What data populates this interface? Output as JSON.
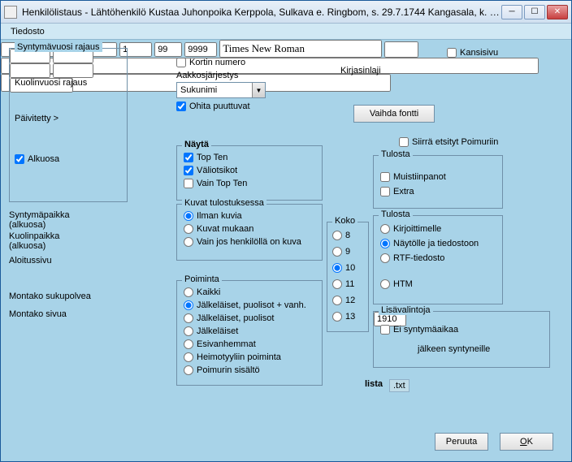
{
  "window": {
    "title": "Henkilölistaus - Lähtöhenkilö Kustaa Juhonpoika Kerppola, Sulkava e. Ringbom,  s. 29.7.1744 Kangasala, k. 1..."
  },
  "menu": {
    "file": "Tiedosto"
  },
  "birthyear": {
    "legend": "Syntymävuosi rajaus",
    "v1": "",
    "v2": ""
  },
  "deathyear": {
    "legend": "Kuolinvuosi rajaus",
    "v1": "",
    "v2": ""
  },
  "updated": {
    "label": "Päivitetty  >",
    "v": ""
  },
  "alkuosa": {
    "label": "Alkuosa"
  },
  "birthplace": {
    "label": "Syntymäpaikka (alkuosa)",
    "v": ""
  },
  "deathplace": {
    "label": "Kuolinpaikka (alkuosa)",
    "v": ""
  },
  "startpage": {
    "label": "Aloitussivu",
    "v": "1"
  },
  "generations": {
    "label": "Montako sukupolvea",
    "v": "99"
  },
  "pages": {
    "label": "Montako sivua",
    "v": "9999"
  },
  "cardno": {
    "label": "Kortin numero"
  },
  "alphaorder": {
    "label": "Aakkosjärjestys",
    "v": "Sukunimi"
  },
  "skipmissing": {
    "label": "Ohita puuttuvat"
  },
  "show": {
    "legend": "Näytä",
    "topten": "Top Ten",
    "subheads": "Väliotsikot",
    "onlytopten": "Vain Top Ten"
  },
  "images": {
    "legend": "Kuvat tulostuksessa",
    "none": "Ilman kuvia",
    "with": "Kuvat mukaan",
    "only": "Vain jos henkilöllä on kuva"
  },
  "pick": {
    "legend": "Poiminta",
    "all": "Kaikki",
    "desc_sp_par": "Jälkeläiset, puolisot + vanh.",
    "desc_sp": "Jälkeläiset, puolisot",
    "desc": "Jälkeläiset",
    "anc": "Esivanhemmat",
    "heimo": "Heimotyyliin poiminta",
    "poimuri": "Poimurin sisältö"
  },
  "size": {
    "legend": "Koko",
    "o1": "8",
    "o2": "9",
    "o3": "10",
    "o4": "11",
    "o5": "12",
    "o6": "13"
  },
  "cover": {
    "label": "Kansisivu"
  },
  "fonttype": {
    "label": "Kirjasinlaji",
    "v": "Times New Roman",
    "change": "Vaihda fontti"
  },
  "movesearched": {
    "label": "Siirrä etsityt Poimuriin"
  },
  "print1": {
    "legend": "Tulosta",
    "notes": "Muistiinpanot",
    "extra": "Extra"
  },
  "print2": {
    "legend": "Tulosta",
    "printer": "Kirjoittimelle",
    "screen": "Näytölle ja tiedostoon",
    "rtf": "RTF-tiedosto",
    "htm": "HTM"
  },
  "extra": {
    "legend": "Lisävalintoja",
    "nobirth": "Ei syntymäaikaa",
    "year": "1910",
    "after": "jälkeen syntyneille"
  },
  "filelabel": {
    "lista": "lista",
    "ext": ".txt",
    "v": ""
  },
  "bottom1": {
    "v": ""
  },
  "bottom2": {
    "v": ""
  },
  "buttons": {
    "cancel": "Peruuta",
    "ok_pre": "O",
    "ok_rest": "K"
  }
}
